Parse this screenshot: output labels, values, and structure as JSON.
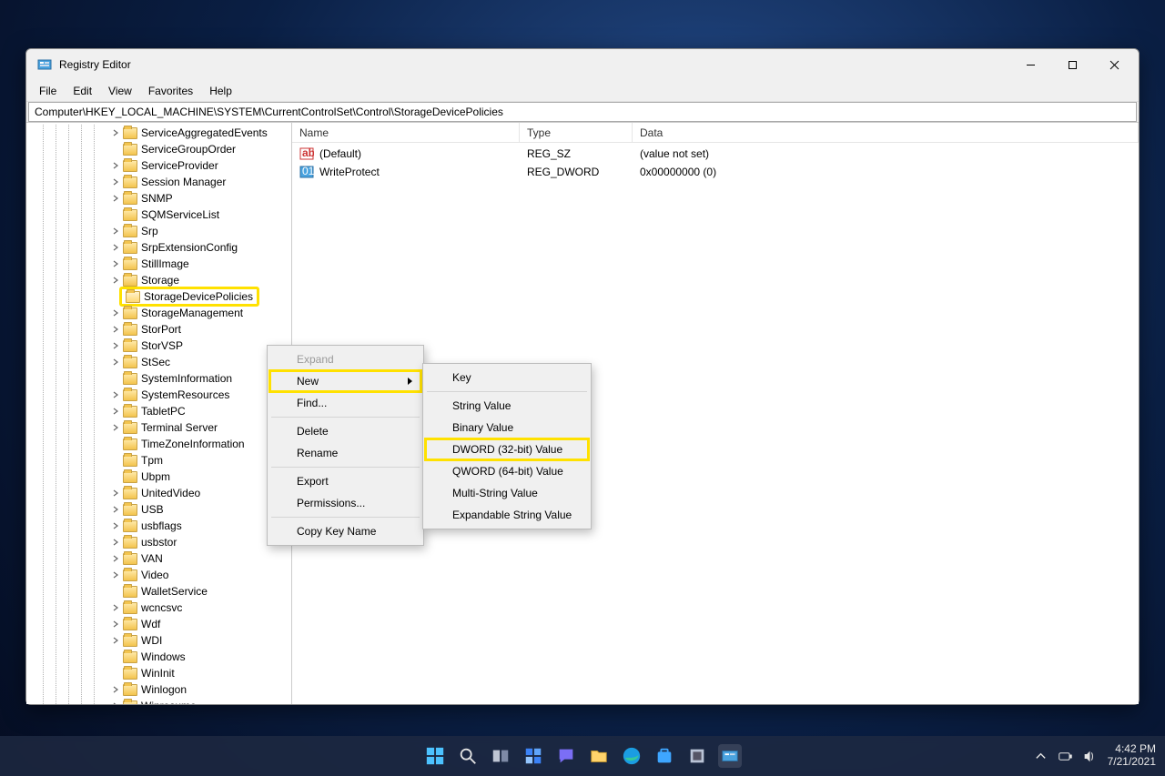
{
  "window": {
    "title": "Registry Editor",
    "controls": {
      "min": "Minimize",
      "max": "Maximize",
      "close": "Close"
    }
  },
  "menubar": [
    "File",
    "Edit",
    "View",
    "Favorites",
    "Help"
  ],
  "address": "Computer\\HKEY_LOCAL_MACHINE\\SYSTEM\\CurrentControlSet\\Control\\StorageDevicePolicies",
  "tree": {
    "nodes": [
      {
        "label": "ServiceAggregatedEvents",
        "chev": "right"
      },
      {
        "label": "ServiceGroupOrder",
        "chev": "none"
      },
      {
        "label": "ServiceProvider",
        "chev": "right"
      },
      {
        "label": "Session Manager",
        "chev": "right"
      },
      {
        "label": "SNMP",
        "chev": "right"
      },
      {
        "label": "SQMServiceList",
        "chev": "none"
      },
      {
        "label": "Srp",
        "chev": "right"
      },
      {
        "label": "SrpExtensionConfig",
        "chev": "right"
      },
      {
        "label": "StillImage",
        "chev": "right"
      },
      {
        "label": "Storage",
        "chev": "right"
      },
      {
        "label": "StorageDevicePolicies",
        "chev": "none",
        "selected": true,
        "open": true
      },
      {
        "label": "StorageManagement",
        "chev": "right"
      },
      {
        "label": "StorPort",
        "chev": "right"
      },
      {
        "label": "StorVSP",
        "chev": "right"
      },
      {
        "label": "StSec",
        "chev": "right"
      },
      {
        "label": "SystemInformation",
        "chev": "none"
      },
      {
        "label": "SystemResources",
        "chev": "right"
      },
      {
        "label": "TabletPC",
        "chev": "right"
      },
      {
        "label": "Terminal Server",
        "chev": "right"
      },
      {
        "label": "TimeZoneInformation",
        "chev": "none"
      },
      {
        "label": "Tpm",
        "chev": "none"
      },
      {
        "label": "Ubpm",
        "chev": "none"
      },
      {
        "label": "UnitedVideo",
        "chev": "right"
      },
      {
        "label": "USB",
        "chev": "right"
      },
      {
        "label": "usbflags",
        "chev": "right"
      },
      {
        "label": "usbstor",
        "chev": "right"
      },
      {
        "label": "VAN",
        "chev": "right"
      },
      {
        "label": "Video",
        "chev": "right"
      },
      {
        "label": "WalletService",
        "chev": "none"
      },
      {
        "label": "wcncsvc",
        "chev": "right"
      },
      {
        "label": "Wdf",
        "chev": "right"
      },
      {
        "label": "WDI",
        "chev": "right"
      },
      {
        "label": "Windows",
        "chev": "none"
      },
      {
        "label": "WinInit",
        "chev": "none"
      },
      {
        "label": "Winlogon",
        "chev": "right"
      },
      {
        "label": "Winresume",
        "chev": "right"
      }
    ]
  },
  "list": {
    "headers": {
      "name": "Name",
      "type": "Type",
      "data": "Data"
    },
    "rows": [
      {
        "icon": "string",
        "name": "(Default)",
        "type": "REG_SZ",
        "data": "(value not set)"
      },
      {
        "icon": "binary",
        "name": "WriteProtect",
        "type": "REG_DWORD",
        "data": "0x00000000 (0)"
      }
    ]
  },
  "context_menu_1": [
    {
      "label": "Expand",
      "disabled": true
    },
    {
      "label": "New",
      "hasarrow": true,
      "highlight": true
    },
    {
      "label": "Find..."
    },
    {
      "sep": true
    },
    {
      "label": "Delete"
    },
    {
      "label": "Rename"
    },
    {
      "sep": true
    },
    {
      "label": "Export"
    },
    {
      "label": "Permissions..."
    },
    {
      "sep": true
    },
    {
      "label": "Copy Key Name"
    }
  ],
  "context_menu_2": [
    {
      "label": "Key"
    },
    {
      "sep": true
    },
    {
      "label": "String Value"
    },
    {
      "label": "Binary Value"
    },
    {
      "label": "DWORD (32-bit) Value",
      "highlight": true
    },
    {
      "label": "QWORD (64-bit) Value"
    },
    {
      "label": "Multi-String Value"
    },
    {
      "label": "Expandable String Value"
    }
  ],
  "taskbar": {
    "icons": [
      "start",
      "search",
      "taskview",
      "widgets",
      "chat",
      "explorer",
      "edge",
      "store",
      "settings",
      "regedit"
    ],
    "tray": {
      "time": "4:42 PM",
      "date": "7/21/2021"
    }
  }
}
